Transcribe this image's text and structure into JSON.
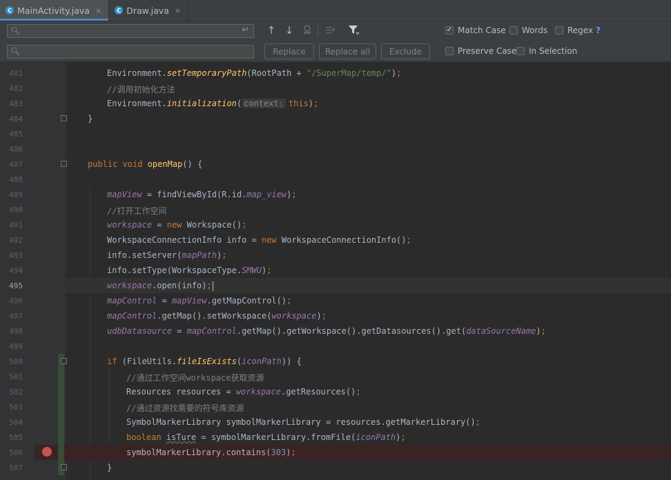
{
  "tabs": [
    {
      "name": "MainActivity.java",
      "icon": "class-c-icon",
      "active": true
    },
    {
      "name": "Draw.java",
      "icon": "class-c-icon",
      "active": false
    }
  ],
  "find_bar": {
    "search_value": "",
    "replace_value": "",
    "buttons": {
      "replace": "Replace",
      "replace_all": "Replace all",
      "exclude": "Exclude"
    },
    "options": {
      "match_case": {
        "label": "Match Case",
        "checked": true
      },
      "words": {
        "label": "Words",
        "checked": false
      },
      "regex": {
        "label": "Regex",
        "checked": false
      },
      "help": "?",
      "preserve_case": {
        "label": "Preserve Case",
        "checked": false
      },
      "in_selection": {
        "label": "In Selection",
        "checked": false
      }
    }
  },
  "editor": {
    "current_line": "495",
    "breakpoint_line": "506",
    "lines": [
      {
        "n": "481",
        "parts": [
          [
            "t",
            "Environment."
          ],
          [
            "m",
            "setTemporaryPath"
          ],
          [
            "t",
            "(RootPath + "
          ],
          [
            "s",
            "\"/SuperMap/temp/\""
          ],
          [
            "t",
            ")"
          ],
          [
            "sc",
            ";"
          ]
        ]
      },
      {
        "n": "482",
        "parts": [
          [
            "c",
            "//调用初始化方法"
          ]
        ]
      },
      {
        "n": "483",
        "parts": [
          [
            "t",
            "Environment."
          ],
          [
            "m",
            "initialization"
          ],
          [
            "t",
            "("
          ],
          [
            "h",
            "context:"
          ],
          [
            "k",
            "this"
          ],
          [
            "t",
            ")"
          ],
          [
            "sc",
            ";"
          ]
        ]
      },
      {
        "n": "484",
        "parts": [
          [
            "t",
            "}"
          ]
        ]
      },
      {
        "n": "485",
        "parts": []
      },
      {
        "n": "486",
        "parts": []
      },
      {
        "n": "487",
        "parts": [
          [
            "k",
            "public void "
          ],
          [
            "y",
            "openMap"
          ],
          [
            "t",
            "() {"
          ]
        ]
      },
      {
        "n": "488",
        "parts": []
      },
      {
        "n": "489",
        "parts": [
          [
            "f",
            "mapView"
          ],
          [
            "t",
            " = findViewById(R.id."
          ],
          [
            "f",
            "map_view"
          ],
          [
            "t",
            ")"
          ],
          [
            "sc",
            ";"
          ]
        ]
      },
      {
        "n": "490",
        "parts": [
          [
            "c",
            "//打开工作空间"
          ]
        ]
      },
      {
        "n": "491",
        "parts": [
          [
            "f",
            "workspace"
          ],
          [
            "t",
            " = "
          ],
          [
            "k",
            "new "
          ],
          [
            "t",
            "Workspace()"
          ],
          [
            "sc",
            ";"
          ]
        ]
      },
      {
        "n": "492",
        "parts": [
          [
            "t",
            "WorkspaceConnectionInfo info = "
          ],
          [
            "k",
            "new "
          ],
          [
            "t",
            "WorkspaceConnectionInfo()"
          ],
          [
            "sc",
            ";"
          ]
        ]
      },
      {
        "n": "493",
        "parts": [
          [
            "t",
            "info.setServer("
          ],
          [
            "p",
            "mapPath"
          ],
          [
            "t",
            ")"
          ],
          [
            "sc",
            ";"
          ]
        ]
      },
      {
        "n": "494",
        "parts": [
          [
            "t",
            "info.setType(WorkspaceType."
          ],
          [
            "f",
            "SMWU"
          ],
          [
            "t",
            ")"
          ],
          [
            "sc",
            ";"
          ]
        ]
      },
      {
        "n": "495",
        "parts": [
          [
            "f",
            "workspace"
          ],
          [
            "t",
            ".open(info)"
          ],
          [
            "sc",
            ";"
          ]
        ]
      },
      {
        "n": "496",
        "parts": [
          [
            "f",
            "mapControl"
          ],
          [
            "t",
            " = "
          ],
          [
            "f",
            "mapView"
          ],
          [
            "t",
            ".getMapControl()"
          ],
          [
            "sc",
            ";"
          ]
        ]
      },
      {
        "n": "497",
        "parts": [
          [
            "f",
            "mapControl"
          ],
          [
            "t",
            ".getMap().setWorkspace("
          ],
          [
            "f",
            "workspace"
          ],
          [
            "t",
            ")"
          ],
          [
            "sc",
            ";"
          ]
        ]
      },
      {
        "n": "498",
        "parts": [
          [
            "f",
            "udbDatasource"
          ],
          [
            "t",
            " = "
          ],
          [
            "f",
            "mapControl"
          ],
          [
            "t",
            ".getMap().getWorkspace().getDatasources().get("
          ],
          [
            "p",
            "dataSourceName"
          ],
          [
            "t",
            ")"
          ],
          [
            "sc",
            ";"
          ]
        ]
      },
      {
        "n": "499",
        "parts": []
      },
      {
        "n": "500",
        "parts": [
          [
            "k",
            "if "
          ],
          [
            "t",
            "(FileUtils."
          ],
          [
            "m",
            "fileIsExists"
          ],
          [
            "t",
            "("
          ],
          [
            "p",
            "iconPath"
          ],
          [
            "t",
            ")) {"
          ]
        ]
      },
      {
        "n": "501",
        "parts": [
          [
            "c",
            "//通过工作空间workspace获取资源"
          ]
        ]
      },
      {
        "n": "502",
        "parts": [
          [
            "t",
            "Resources resources = "
          ],
          [
            "f",
            "workspace"
          ],
          [
            "t",
            ".getResources()"
          ],
          [
            "sc",
            ";"
          ]
        ]
      },
      {
        "n": "503",
        "parts": [
          [
            "c",
            "//通过资源找需要的符号库资源"
          ]
        ]
      },
      {
        "n": "504",
        "parts": [
          [
            "t",
            "SymbolMarkerLibrary symbolMarkerLibrary = resources.getMarkerLibrary()"
          ],
          [
            "sc",
            ";"
          ]
        ]
      },
      {
        "n": "505",
        "parts": [
          [
            "k",
            "boolean "
          ],
          [
            "u",
            "isTure"
          ],
          [
            "t",
            " = symbolMarkerLibrary.fromFile("
          ],
          [
            "p",
            "iconPath"
          ],
          [
            "t",
            ")"
          ],
          [
            "sc",
            ";"
          ]
        ]
      },
      {
        "n": "506",
        "parts": [
          [
            "t",
            "symbolMarkerLibrary.contains("
          ],
          [
            "n",
            "303"
          ],
          [
            "t",
            ")"
          ],
          [
            "sc",
            ";"
          ]
        ]
      },
      {
        "n": "507",
        "parts": [
          [
            "t",
            "}"
          ]
        ]
      }
    ]
  },
  "colors": {
    "accent": "#4a88c7",
    "breakpoint": "#c75450",
    "keyword": "#cc7832",
    "string": "#6a8759",
    "field": "#9876aa",
    "method": "#ffc66d"
  }
}
